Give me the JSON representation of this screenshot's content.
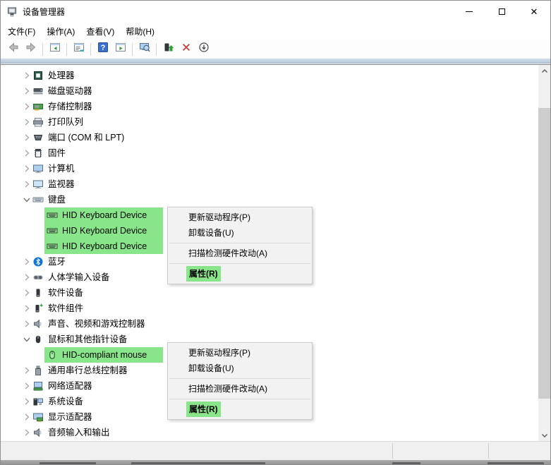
{
  "window": {
    "title": "设备管理器",
    "caption_buttons": [
      {
        "name": "minimize"
      },
      {
        "name": "maximize"
      },
      {
        "name": "close"
      }
    ]
  },
  "menu_bar": {
    "items": [
      {
        "label": "文件(F)"
      },
      {
        "label": "操作(A)"
      },
      {
        "label": "查看(V)"
      },
      {
        "label": "帮助(H)"
      }
    ]
  },
  "toolbar": {
    "buttons": [
      {
        "name": "back"
      },
      {
        "name": "forward"
      },
      {
        "type": "separator"
      },
      {
        "name": "show-console-tree"
      },
      {
        "type": "separator"
      },
      {
        "name": "properties"
      },
      {
        "type": "separator"
      },
      {
        "name": "help"
      },
      {
        "name": "show-action-pane"
      },
      {
        "type": "separator"
      },
      {
        "name": "scan-hardware-changes"
      },
      {
        "type": "separator"
      },
      {
        "name": "update-driver"
      },
      {
        "name": "uninstall-device"
      },
      {
        "name": "disable-device"
      }
    ]
  },
  "tree": {
    "items": [
      {
        "name": "processors",
        "label": "处理器",
        "icon": "cpu",
        "level": 0,
        "state": "collapsed"
      },
      {
        "name": "disk-drives",
        "label": "磁盘驱动器",
        "icon": "disk",
        "level": 0,
        "state": "collapsed"
      },
      {
        "name": "storage-controllers",
        "label": "存储控制器",
        "icon": "storage",
        "level": 0,
        "state": "collapsed"
      },
      {
        "name": "print-queues",
        "label": "打印队列",
        "icon": "printer",
        "level": 0,
        "state": "collapsed"
      },
      {
        "name": "ports-com-lpt",
        "label": "端口 (COM 和 LPT)",
        "icon": "port",
        "level": 0,
        "state": "collapsed"
      },
      {
        "name": "firmware",
        "label": "固件",
        "icon": "firmware",
        "level": 0,
        "state": "collapsed"
      },
      {
        "name": "computer",
        "label": "计算机",
        "icon": "computer",
        "level": 0,
        "state": "collapsed"
      },
      {
        "name": "monitors",
        "label": "监视器",
        "icon": "monitor",
        "level": 0,
        "state": "collapsed"
      },
      {
        "name": "keyboards",
        "label": "键盘",
        "icon": "keyboard",
        "level": 0,
        "state": "expanded"
      },
      {
        "name": "hid-keyboard-device-1",
        "label": "HID Keyboard Device",
        "icon": "keyboard-green",
        "level": 1,
        "highlighted": true
      },
      {
        "name": "hid-keyboard-device-2",
        "label": "HID Keyboard Device",
        "icon": "keyboard-green",
        "level": 1,
        "highlighted": true
      },
      {
        "name": "hid-keyboard-device-3",
        "label": "HID Keyboard Device",
        "icon": "keyboard-green",
        "level": 1,
        "highlighted": true
      },
      {
        "name": "bluetooth",
        "label": "蓝牙",
        "icon": "bluetooth",
        "level": 0,
        "state": "collapsed"
      },
      {
        "name": "human-interface",
        "label": "人体学输入设备",
        "icon": "hid",
        "level": 0,
        "state": "collapsed"
      },
      {
        "name": "software-devices",
        "label": "软件设备",
        "icon": "software-device",
        "level": 0,
        "state": "collapsed"
      },
      {
        "name": "software-components",
        "label": "软件组件",
        "icon": "software-component",
        "level": 0,
        "state": "collapsed"
      },
      {
        "name": "sound-video-game",
        "label": "声音、视频和游戏控制器",
        "icon": "audio-controller",
        "level": 0,
        "state": "collapsed"
      },
      {
        "name": "mice-pointing",
        "label": "鼠标和其他指针设备",
        "icon": "mouse",
        "level": 0,
        "state": "expanded"
      },
      {
        "name": "hid-compliant-mouse",
        "label": "HID-compliant mouse",
        "icon": "mouse-green",
        "level": 1,
        "highlighted": true
      },
      {
        "name": "usb-controllers",
        "label": "通用串行总线控制器",
        "icon": "usb",
        "level": 0,
        "state": "collapsed"
      },
      {
        "name": "network-adapters",
        "label": "网络适配器",
        "icon": "network",
        "level": 0,
        "state": "collapsed"
      },
      {
        "name": "system-devices",
        "label": "系统设备",
        "icon": "system",
        "level": 0,
        "state": "collapsed"
      },
      {
        "name": "display-adapters",
        "label": "显示适配器",
        "icon": "display",
        "level": 0,
        "state": "collapsed"
      },
      {
        "name": "audio-inputs-outputs",
        "label": "音频输入和输出",
        "icon": "audio-endpoint",
        "level": 0,
        "state": "collapsed"
      }
    ]
  },
  "context_menus": [
    {
      "name": "context-menu-keyboard",
      "items": [
        {
          "name": "update-driver",
          "label": "更新驱动程序(P)"
        },
        {
          "name": "uninstall-device",
          "label": "卸载设备(U)"
        },
        {
          "type": "separator"
        },
        {
          "name": "scan-hardware-changes",
          "label": "扫描检测硬件改动(A)"
        },
        {
          "type": "separator"
        },
        {
          "name": "properties",
          "label": "属性(R)",
          "bold": true,
          "highlighted": true
        }
      ]
    },
    {
      "name": "context-menu-mouse",
      "items": [
        {
          "name": "update-driver",
          "label": "更新驱动程序(P)"
        },
        {
          "name": "uninstall-device",
          "label": "卸载设备(U)"
        },
        {
          "type": "separator"
        },
        {
          "name": "scan-hardware-changes",
          "label": "扫描检测硬件改动(A)"
        },
        {
          "type": "separator"
        },
        {
          "name": "properties",
          "label": "属性(R)",
          "bold": true,
          "highlighted": true
        }
      ]
    }
  ],
  "colors": {
    "selection_green": "#89E589",
    "menu_bg": "#F2F2F2",
    "band_blue": "#C7D8E8",
    "statusbar_bg": "#F0F0F0",
    "bluetooth_blue": "#1274D6",
    "help_blue": "#3A6ECB",
    "uninstall_red": "#C23B3B"
  }
}
